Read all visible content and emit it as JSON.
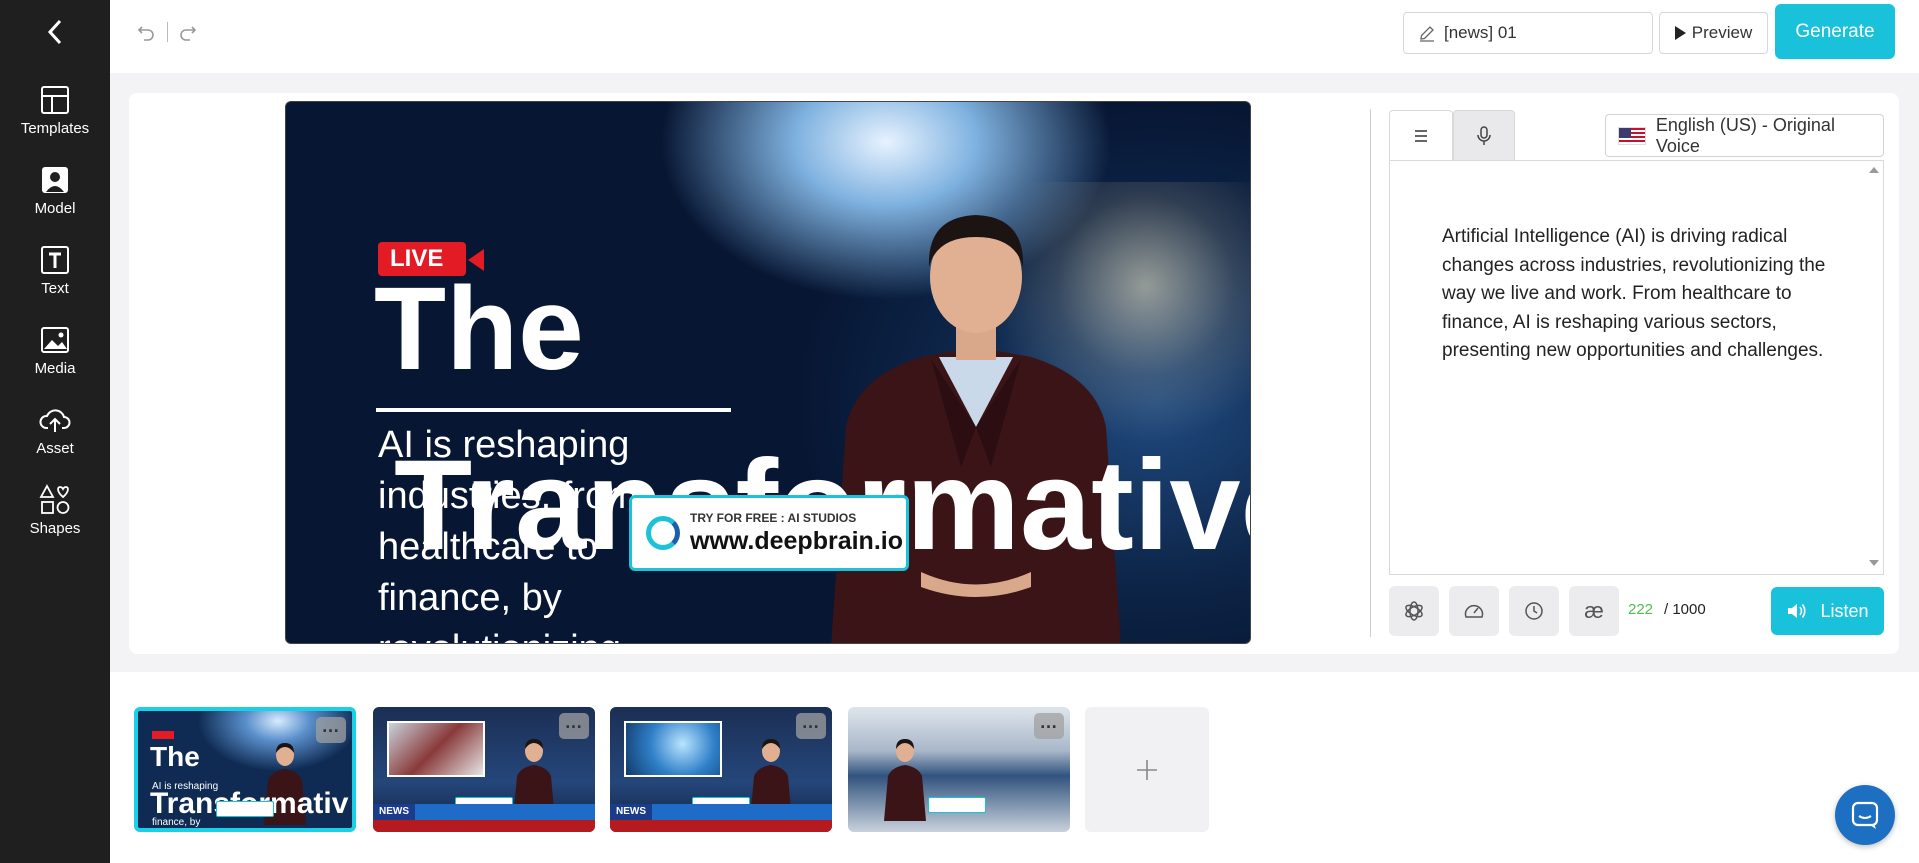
{
  "sidebar": {
    "items": [
      {
        "label": "Templates",
        "icon": "template-icon"
      },
      {
        "label": "Model",
        "icon": "model-icon"
      },
      {
        "label": "Text",
        "icon": "text-icon"
      },
      {
        "label": "Media",
        "icon": "media-icon"
      },
      {
        "label": "Asset",
        "icon": "upload-cloud-icon"
      },
      {
        "label": "Shapes",
        "icon": "shapes-icon"
      }
    ]
  },
  "toolbar": {
    "project_title": "[news] 01",
    "preview_label": "Preview",
    "generate_label": "Generate"
  },
  "canvas": {
    "live_label": "LIVE",
    "headline": "The",
    "body_text": "AI is reshaping industries, from healthcare to finance, by revolutionizing the",
    "big_text": "Transformative",
    "watermark_small": "TRY FOR FREE : AI STUDIOS",
    "watermark_url": "www.deepbrain.io"
  },
  "script_panel": {
    "voice_language": "English (US) - Original Voice",
    "script_text": "Artificial Intelligence (AI) is driving radical changes across industries, revolutionizing the way we live and work. From healthcare to finance, AI is reshaping various sectors, presenting new opportunities and challenges.",
    "char_count": "222",
    "char_limit": "/ 1000",
    "listen_label": "Listen",
    "tools": [
      "openai-icon",
      "speed-gauge-icon",
      "clock-icon",
      "pronunciation-icon"
    ]
  },
  "scenes": [
    {
      "live": "LIVE",
      "headline": "The",
      "sub": "AI is reshaping",
      "big": "Transformativ",
      "extra": "finance, by",
      "selected": true
    },
    {
      "news": "NEWS",
      "selected": false
    },
    {
      "news": "NEWS",
      "selected": false
    },
    {
      "selected": false
    }
  ],
  "colors": {
    "accent": "#19c2da",
    "sidebar_bg": "#1f1f1f",
    "live_red": "#e21b24",
    "char_count_green": "#4fbf4f"
  }
}
